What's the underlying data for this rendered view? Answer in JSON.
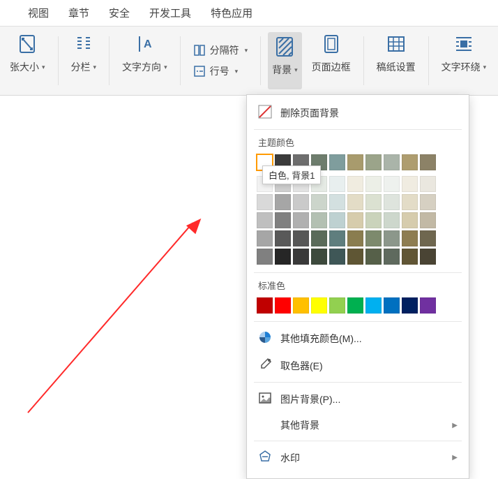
{
  "menubar": [
    "视图",
    "章节",
    "安全",
    "开发工具",
    "特色应用"
  ],
  "ribbon": {
    "size": "张大小",
    "columns": "分栏",
    "text_direction": "文字方向",
    "separator": "分隔符",
    "line_number": "行号",
    "background": "背景",
    "page_border": "页面边框",
    "writing_paper": "稿纸设置",
    "text_wrap": "文字环绕"
  },
  "dropdown": {
    "remove_bg": "删除页面背景",
    "theme_colors_label": "主题颜色",
    "standard_colors_label": "标准色",
    "more_fill": "其他填充颜色(M)...",
    "eyedropper": "取色器(E)",
    "picture_bg": "图片背景(P)...",
    "other_bg": "其他背景",
    "watermark": "水印",
    "tooltip": "白色, 背景1",
    "theme_grid": [
      [
        "#ffffff",
        "#3b3b3b",
        "#6e6e6e",
        "#6e7d6d",
        "#7f9d9d",
        "#a89b6d",
        "#9ba48a",
        "#aab4a9",
        "#ae9d6f",
        "#8c8267"
      ],
      [
        "#f2f2f2",
        "#cfcfcf",
        "#e3e3e3",
        "#e5eae4",
        "#e8efef",
        "#f0ece0",
        "#ecefe7",
        "#eef1ee",
        "#f0ece1",
        "#eae7df"
      ],
      [
        "#d9d9d9",
        "#a6a6a6",
        "#cacaca",
        "#ccd5cb",
        "#d3e0e0",
        "#e3dcc6",
        "#dbe1d1",
        "#dee4dd",
        "#e3dcc7",
        "#d6d0c2"
      ],
      [
        "#bfbfbf",
        "#808080",
        "#b0b0b0",
        "#b3c0b2",
        "#bed1d1",
        "#d6ccac",
        "#cad3bb",
        "#cdd7cc",
        "#d6ccad",
        "#c2b9a5"
      ],
      [
        "#a6a6a6",
        "#595959",
        "#575757",
        "#5a6b5a",
        "#5f7e7e",
        "#8a7d4f",
        "#7d8a6d",
        "#8c978b",
        "#8e7d51",
        "#6f674f"
      ],
      [
        "#808080",
        "#262626",
        "#3a3a3a",
        "#3d4a3d",
        "#3f5757",
        "#5f5634",
        "#566049",
        "#5f6a5e",
        "#615635",
        "#4a4434"
      ]
    ],
    "standard_row": [
      "#c00000",
      "#ff0000",
      "#ffc000",
      "#ffff00",
      "#92d050",
      "#00b050",
      "#00b0f0",
      "#0070c0",
      "#002060",
      "#7030a0"
    ]
  }
}
